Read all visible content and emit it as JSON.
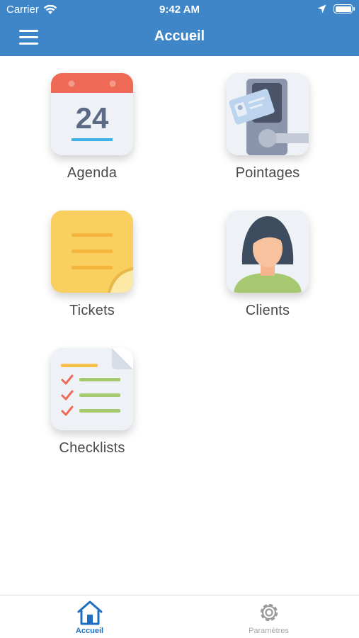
{
  "status_bar": {
    "carrier": "Carrier",
    "time": "9:42 AM"
  },
  "header": {
    "title": "Accueil"
  },
  "tiles": [
    {
      "label": "Agenda",
      "date_number": "24"
    },
    {
      "label": "Pointages"
    },
    {
      "label": "Tickets"
    },
    {
      "label": "Clients"
    },
    {
      "label": "Checklists"
    }
  ],
  "tab_bar": {
    "tabs": [
      {
        "label": "Accueil",
        "active": true
      },
      {
        "label": "Paramètres",
        "active": false
      }
    ]
  },
  "colors": {
    "header": "#3f86c8",
    "active_tab": "#1f6fc0",
    "inactive_tab": "#a6a6a6"
  }
}
